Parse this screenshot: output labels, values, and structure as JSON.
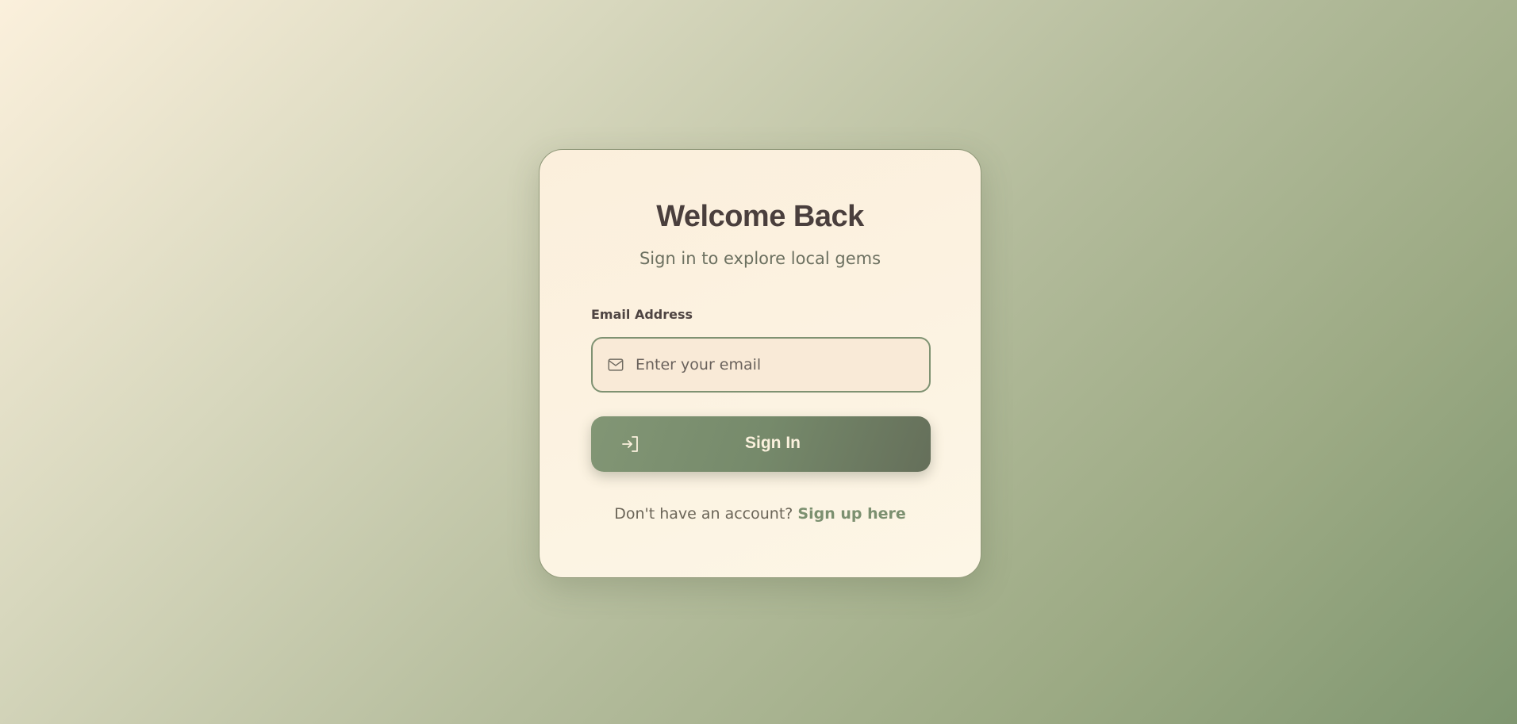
{
  "card": {
    "title": "Welcome Back",
    "subtitle": "Sign in to explore local gems"
  },
  "form": {
    "email_label": "Email Address",
    "email_placeholder": "Enter your email",
    "email_icon": "mail-icon",
    "submit_label": "Sign In",
    "submit_icon": "sign-in-icon"
  },
  "footer": {
    "prompt": "Don't have an account?",
    "signup_link": "Sign up here"
  },
  "colors": {
    "accent": "#7f9272",
    "title_text": "#4a3f3d",
    "card_background": "#fcf3e2",
    "button_text": "#fbf1dd"
  }
}
